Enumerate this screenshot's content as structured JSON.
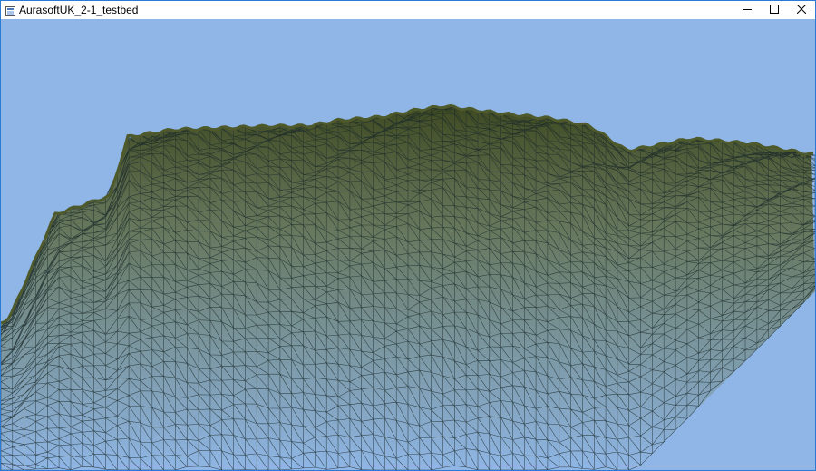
{
  "window": {
    "title": "AurasoftUK_2-1_testbed"
  },
  "titlebar": {
    "icons": [
      "app-icon",
      "minimize-icon",
      "maximize-icon",
      "close-icon"
    ]
  },
  "viewport": {
    "sky_color": "#8fb6e6",
    "terrain_color": "#4f5a2c",
    "wire_color": "#1c2a2a"
  }
}
